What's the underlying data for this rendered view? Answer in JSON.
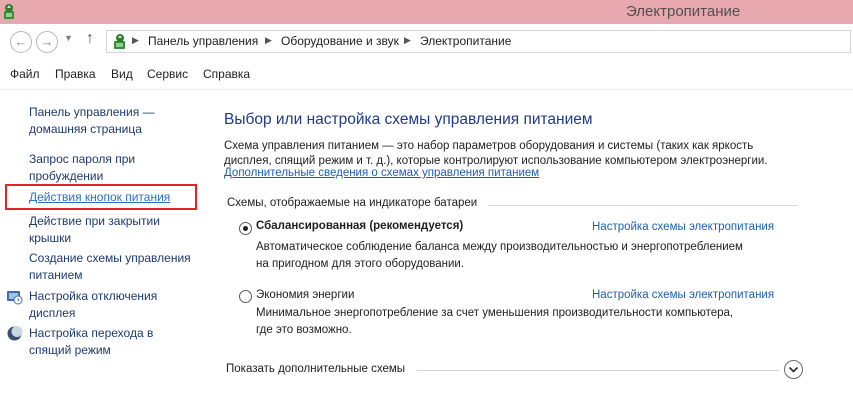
{
  "window": {
    "title": "Электропитание"
  },
  "address_bar": {
    "crumbs": [
      "Панель управления",
      "Оборудование и звук",
      "Электропитание"
    ]
  },
  "menu": {
    "items": [
      "Файл",
      "Правка",
      "Вид",
      "Сервис",
      "Справка"
    ]
  },
  "sidebar": {
    "items": [
      {
        "label_line1": "Панель управления —",
        "label_line2": "домашняя страница"
      },
      {
        "label_line1": "Запрос пароля при",
        "label_line2": "пробуждении"
      },
      {
        "label_line1": "Действия кнопок питания",
        "label_line2": ""
      },
      {
        "label_line1": "Действие при закрытии",
        "label_line2": "крышки"
      },
      {
        "label_line1": "Создание схемы управления",
        "label_line2": "питанием"
      },
      {
        "label_line1": "Настройка отключения",
        "label_line2": "дисплея"
      },
      {
        "label_line1": "Настройка перехода в",
        "label_line2": "спящий режим"
      }
    ]
  },
  "main": {
    "title": "Выбор или настройка схемы управления питанием",
    "description_line1": "Схема управления питанием — это набор параметров оборудования и системы (таких как яркость",
    "description_line2": "дисплея, спящий режим и т. д.), которые контролируют использование компьютером электроэнергии.",
    "more_info_link": "Дополнительные сведения о схемах управления питанием",
    "group_label": "Схемы, отображаемые на индикаторе батареи",
    "plans": [
      {
        "name": "Сбалансированная (рекомендуется)",
        "selected": true,
        "settings_link": "Настройка схемы электропитания",
        "desc_line1": "Автоматическое соблюдение баланса между производительностью и энергопотреблением",
        "desc_line2": "на пригодном для этого оборудовании."
      },
      {
        "name": "Экономия энергии",
        "selected": false,
        "settings_link": "Настройка схемы электропитания",
        "desc_line1": "Минимальное энергопотребление за счет уменьшения производительности компьютера,",
        "desc_line2": "где это возможно."
      }
    ],
    "show_more": "Показать дополнительные схемы"
  },
  "colors": {
    "titlebar_bg": "#e8a8b0",
    "link": "#1f5fb0",
    "heading": "#1e3a8a",
    "highlight_border": "#e0242a"
  }
}
